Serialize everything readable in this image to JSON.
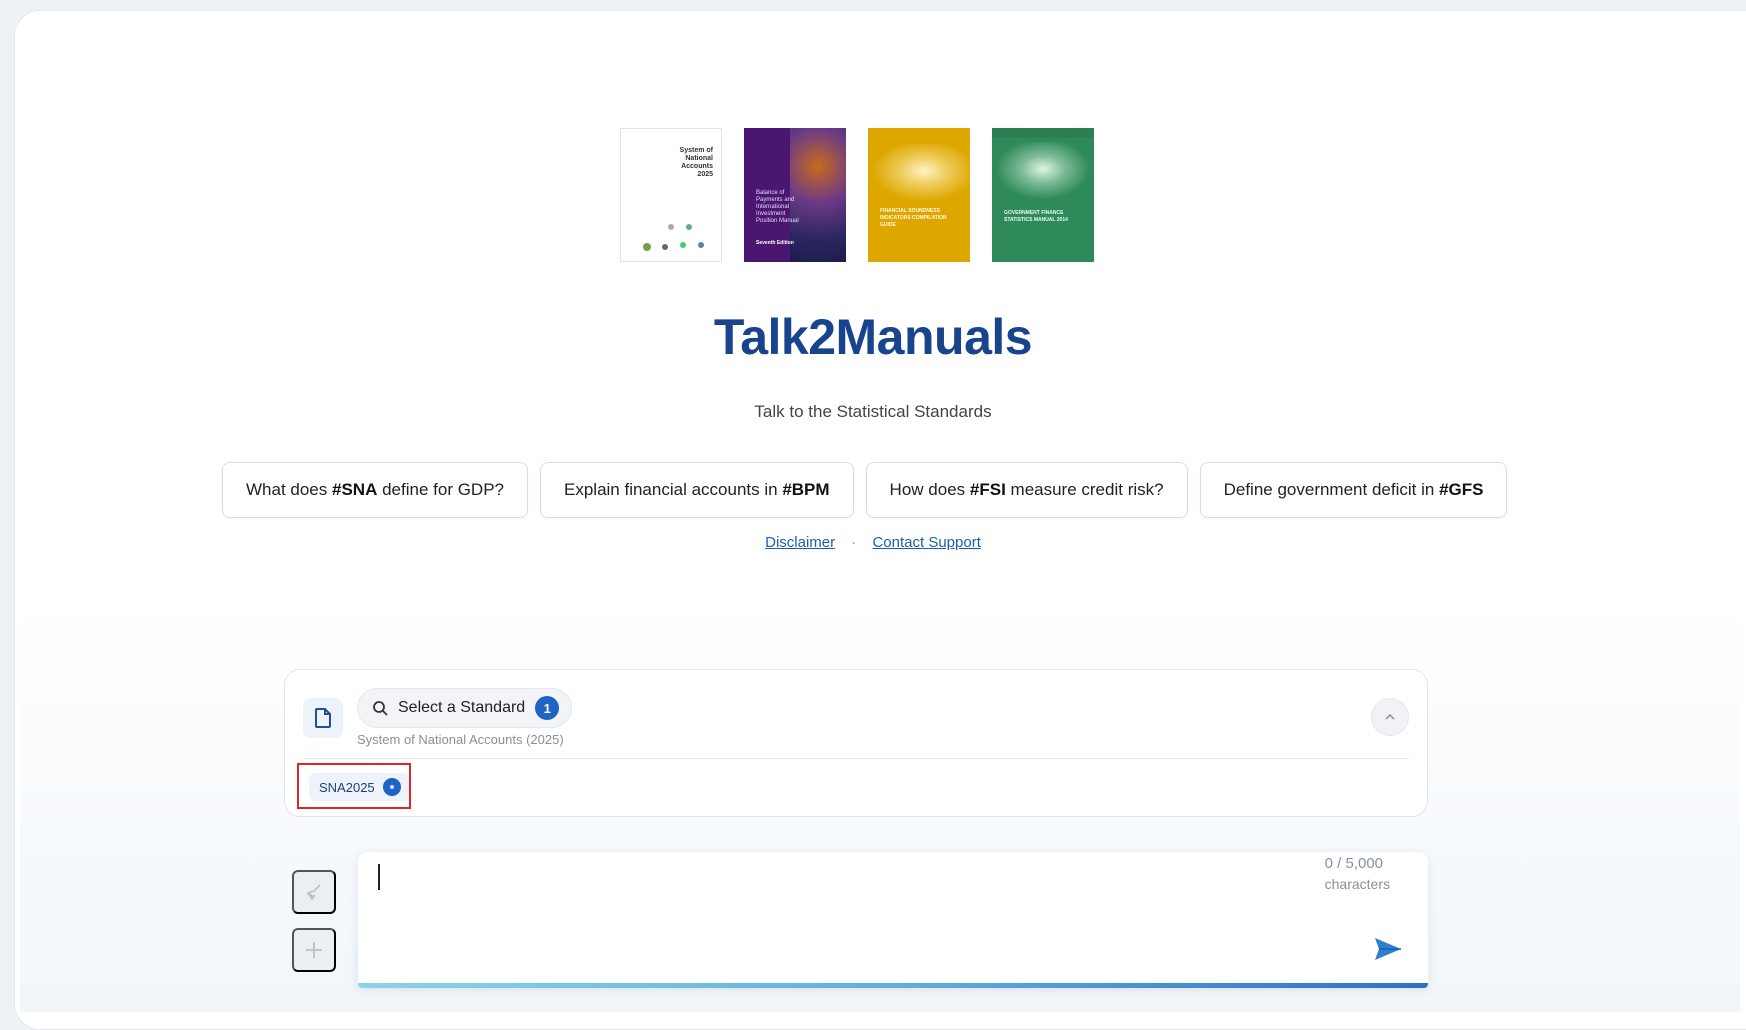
{
  "app": {
    "title": "Talk2Manuals",
    "subtitle": "Talk to the Statistical Standards"
  },
  "covers": {
    "sna": {
      "lines": [
        "System of",
        "National",
        "Accounts",
        "2025"
      ]
    },
    "bpm": {
      "title": "Balance of Payments and International Investment Position Manual",
      "edition": "Seventh Edition"
    },
    "fsi": {
      "title": "FINANCIAL SOUNDNESS INDICATORS COMPILATION GUIDE"
    },
    "gfs": {
      "title": "GOVERNMENT FINANCE STATISTICS MANUAL 2014"
    }
  },
  "suggestions": [
    {
      "before": "What does ",
      "tag": "#SNA",
      "after": " define for GDP?"
    },
    {
      "before": "Explain financial accounts in ",
      "tag": "#BPM",
      "after": ""
    },
    {
      "before": "How does ",
      "tag": "#FSI",
      "after": " measure credit risk?"
    },
    {
      "before": "Define government deficit in ",
      "tag": "#GFS",
      "after": ""
    }
  ],
  "links": {
    "disclaimer": "Disclaimer",
    "separator": "·",
    "contact": "Contact Support"
  },
  "standard_selector": {
    "label": "Select a Standard",
    "count": "1",
    "selected_name": "System of National Accounts (2025)",
    "chip": "SNA2025"
  },
  "chat_input": {
    "value": "",
    "char_count": "0 / 5,000",
    "char_label": "characters"
  },
  "colors": {
    "brand": "#17448d",
    "accent": "#1f63c7",
    "highlight": "#d8282a"
  },
  "icons": {
    "doc": "document-icon",
    "search": "search-icon",
    "collapse": "chevron-up-icon",
    "clear": "broom-icon",
    "add": "plus-icon",
    "send": "send-icon"
  }
}
